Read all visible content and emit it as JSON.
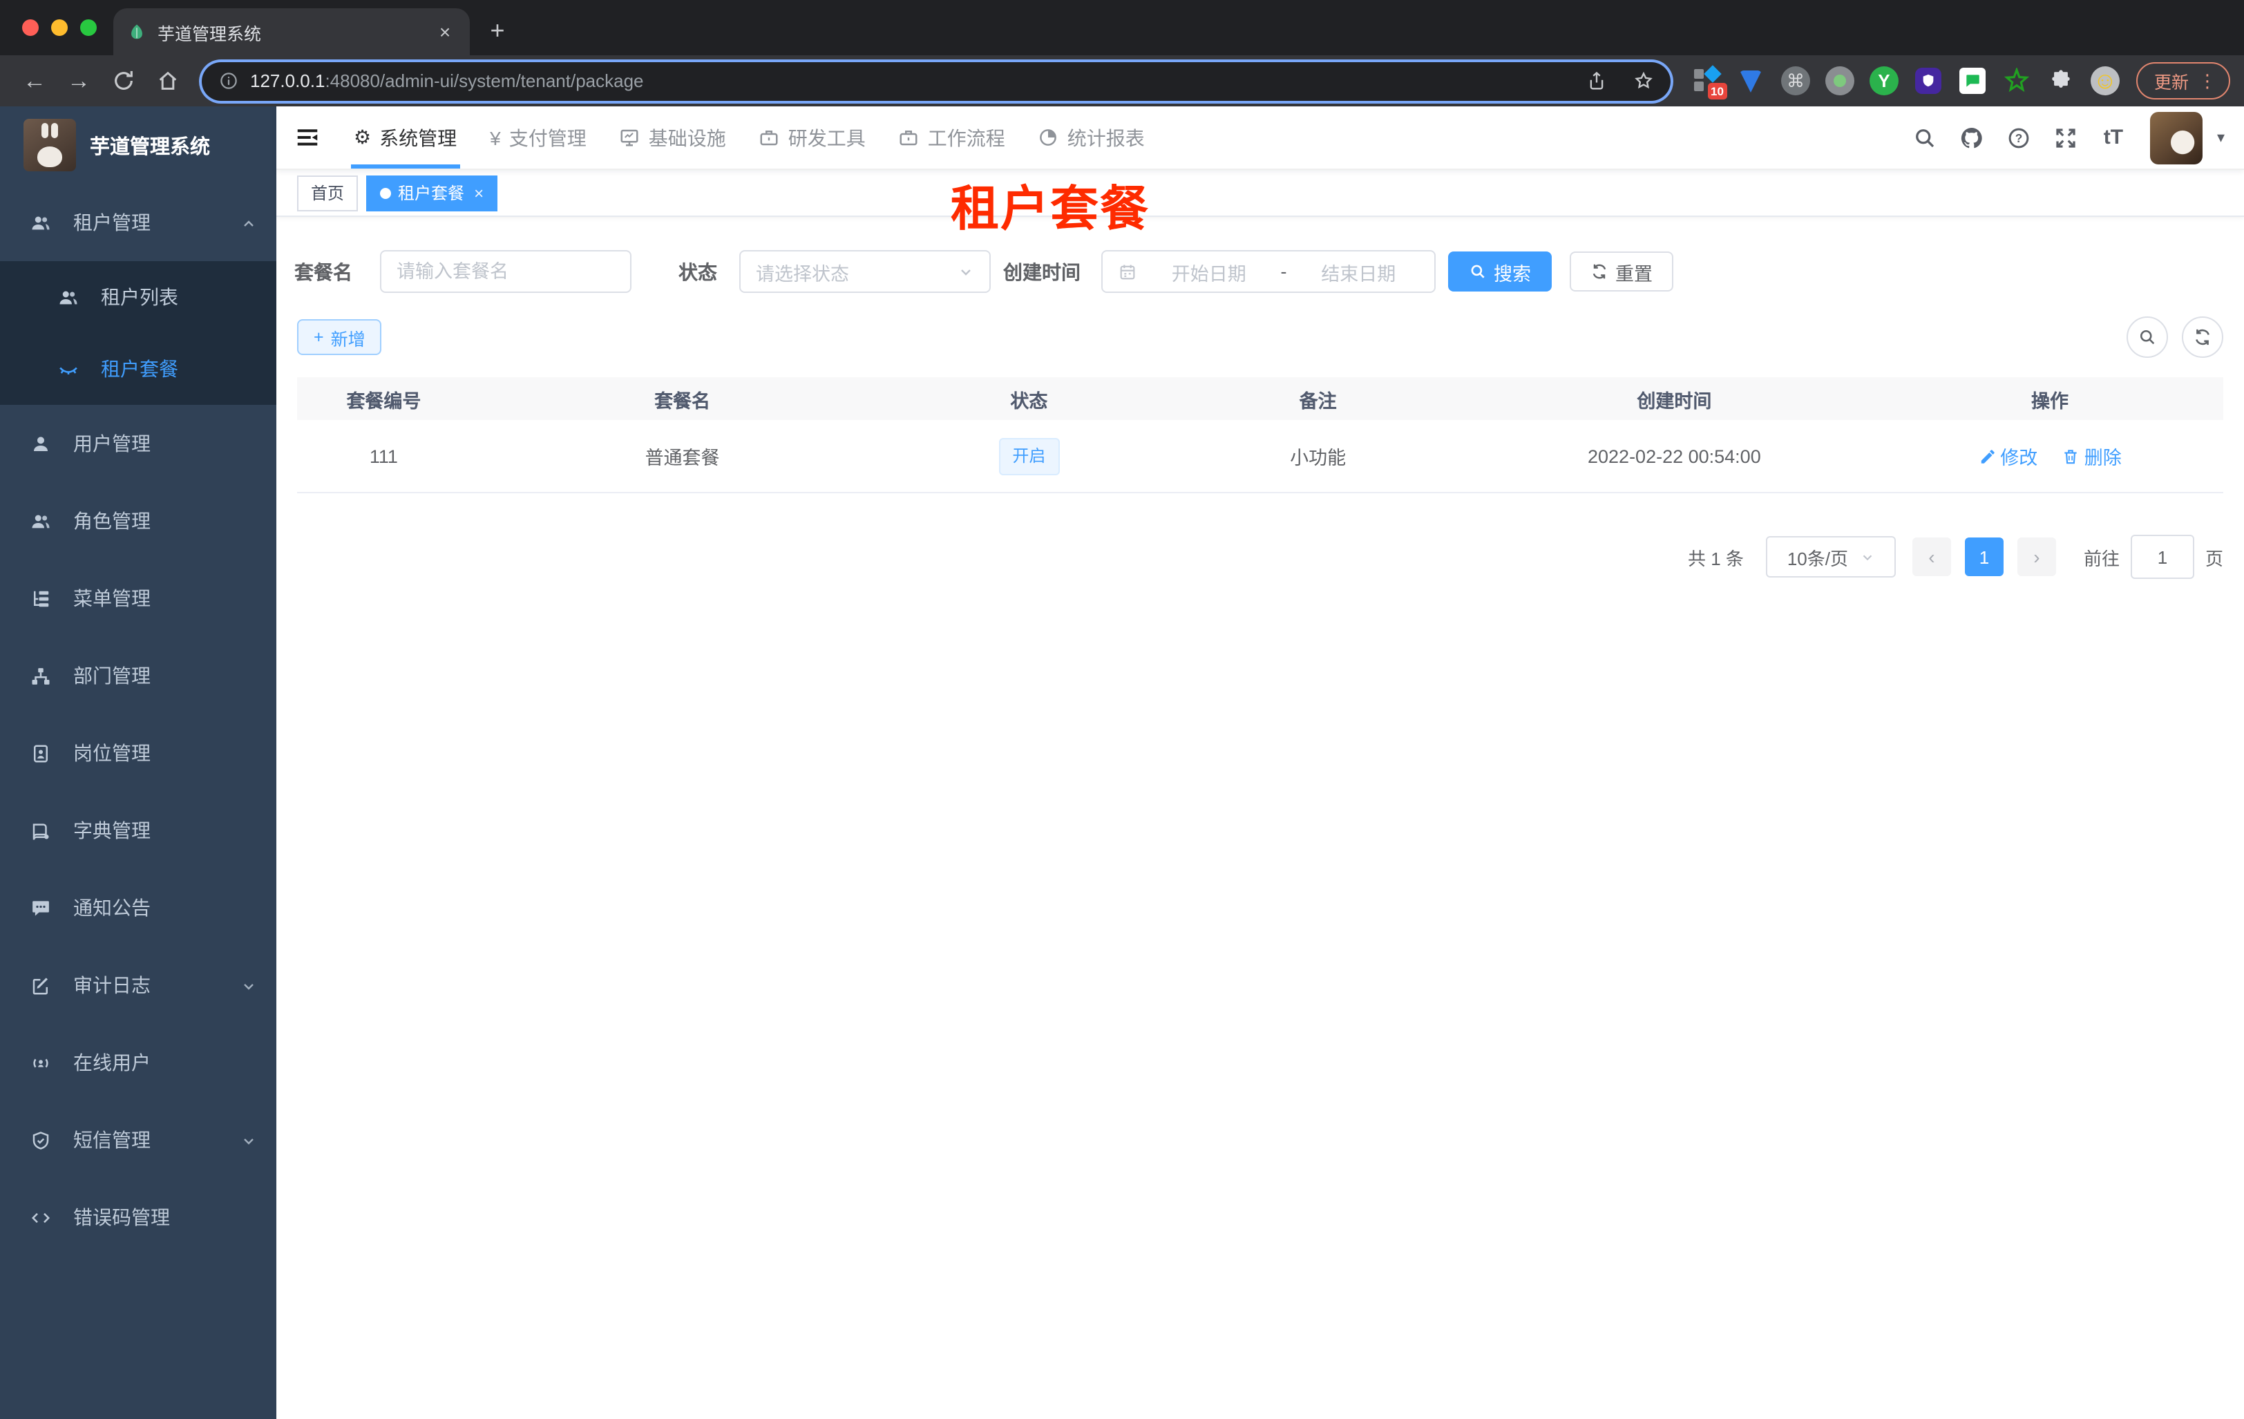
{
  "colors": {
    "accent": "#409eff",
    "annotation_red": "#fe2b00",
    "sidebar_bg": "#304156",
    "submenu_bg": "#1f2d3d",
    "chrome_bg": "#202124",
    "chrome_toolbar": "#35363a",
    "status_tag_bg": "#ecf5ff"
  },
  "glyphs": {
    "close": "×",
    "plus": "+",
    "back": "←",
    "forward": "→",
    "caret_down": "▾",
    "kebab": "⋮",
    "cmd": "⌘",
    "smile": "☺",
    "chevron_left": "‹",
    "chevron_right": "›",
    "gear": "⚙",
    "yen": "¥",
    "letter_y": "Y",
    "text_size": "tT"
  },
  "browser": {
    "tab_title": "芋道管理系统",
    "url_host": "127.0.0.1",
    "url_rest": ":48080/admin-ui/system/tenant/package",
    "extensions_badge": "10",
    "update_label": "更新"
  },
  "sidebar": {
    "logo_title": "芋道管理系统",
    "items": [
      {
        "label": "租户管理"
      },
      {
        "label": "租户列表"
      },
      {
        "label": "租户套餐"
      },
      {
        "label": "用户管理"
      },
      {
        "label": "角色管理"
      },
      {
        "label": "菜单管理"
      },
      {
        "label": "部门管理"
      },
      {
        "label": "岗位管理"
      },
      {
        "label": "字典管理"
      },
      {
        "label": "通知公告"
      },
      {
        "label": "审计日志"
      },
      {
        "label": "在线用户"
      },
      {
        "label": "短信管理"
      },
      {
        "label": "错误码管理"
      }
    ]
  },
  "navbar": {
    "menus": [
      {
        "label": "系统管理"
      },
      {
        "label": "支付管理"
      },
      {
        "label": "基础设施"
      },
      {
        "label": "研发工具"
      },
      {
        "label": "工作流程"
      },
      {
        "label": "统计报表"
      }
    ]
  },
  "tags": {
    "home": "首页",
    "current": "租户套餐"
  },
  "annotation": "租户套餐",
  "filters": {
    "name_label": "套餐名",
    "name_placeholder": "请输入套餐名",
    "status_label": "状态",
    "status_placeholder": "请选择状态",
    "date_label": "创建时间",
    "date_start": "开始日期",
    "date_sep": "-",
    "date_end": "结束日期",
    "search": "搜索",
    "reset": "重置",
    "add": "新增"
  },
  "table": {
    "headers": [
      "套餐编号",
      "套餐名",
      "状态",
      "备注",
      "创建时间",
      "操作"
    ],
    "rows": [
      {
        "id": "111",
        "name": "普通套餐",
        "status": "开启",
        "remark": "小功能",
        "created": "2022-02-22 00:54:00",
        "edit": "修改",
        "delete": "删除"
      }
    ]
  },
  "pagination": {
    "total": "共 1 条",
    "page_size": "10条/页",
    "page": "1",
    "goto_label": "前往",
    "goto_value": "1",
    "goto_unit": "页"
  }
}
